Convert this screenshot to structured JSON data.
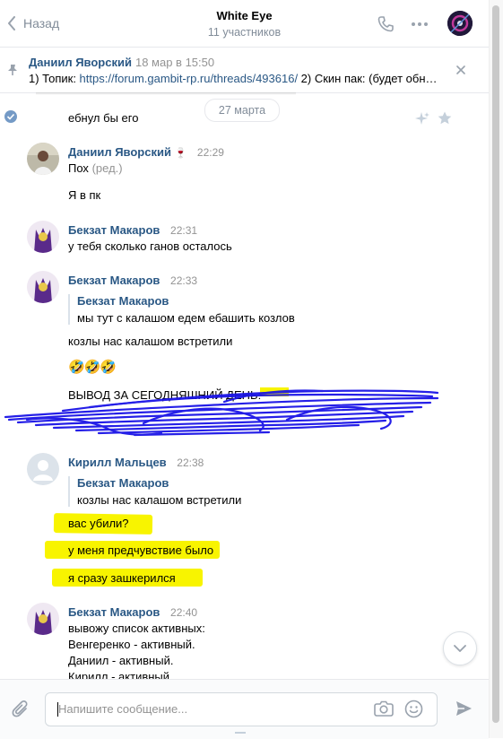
{
  "header": {
    "back_label": "Назад",
    "title": "White Eye",
    "subtitle": "11 участников"
  },
  "pinned": {
    "author": "Даниил Яворский",
    "date": "18 мар в 15:50",
    "text_prefix": "1) Топик: ",
    "link": "https://forum.gambit-rp.ru/threads/493616/",
    "text_suffix": " 2) Скин пак: (будет обн…"
  },
  "date_divider": "27 марта",
  "messages": {
    "m0": {
      "text": "ебнул бы его"
    },
    "m1": {
      "author": "Даниил Яворский",
      "emoji": "🍷",
      "time": "22:29",
      "line1": "Пох",
      "edited": "(ред.)",
      "line2": "Я в пк"
    },
    "m2": {
      "author": "Бекзат Макаров",
      "time": "22:31",
      "text": "у тебя сколько ганов осталось"
    },
    "m3": {
      "author": "Бекзат Макаров",
      "time": "22:33",
      "fwd_author": "Бекзат Макаров",
      "fwd_text": "мы тут с калашом едем ебашить козлов",
      "line1": "козлы нас калашом встретили",
      "emojis": "🤣🤣🤣",
      "line3": "ВЫВОД ЗА СЕГОДНЯШНИЙ ДЕНЬ: "
    },
    "m4": {
      "author": "Кирилл Мальцев",
      "time": "22:38",
      "fwd_author": "Бекзат Макаров",
      "fwd_text": "козлы нас калашом встретили",
      "line1": "вас убили?",
      "line2": "у меня предчувствие было",
      "line3": "я сразу зашкерился"
    },
    "m5": {
      "author": "Бекзат Макаров",
      "time": "22:40",
      "lines": [
        "вывожу список активных:",
        "Венгеренко - активный.",
        "Даниил - активный.",
        "Кирилл - активный."
      ]
    }
  },
  "composer": {
    "placeholder": "Напишите сообщение..."
  },
  "colors": {
    "link": "#2a5885",
    "muted": "#818c99",
    "highlight": "#f8f400",
    "scribble": "#1a14e6",
    "accent": "#5181b8"
  }
}
